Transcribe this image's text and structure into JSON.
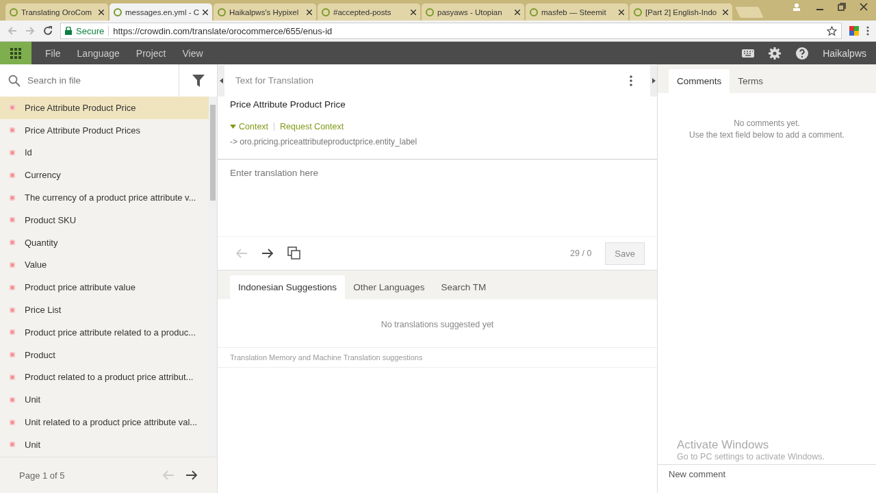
{
  "browser": {
    "tabs": [
      {
        "title": "Translating OroCom",
        "selected": false
      },
      {
        "title": "messages.en.yml - C",
        "selected": true
      },
      {
        "title": "Haikalpws's Hypixel",
        "selected": false
      },
      {
        "title": "#accepted-posts",
        "selected": false
      },
      {
        "title": "pasyaws - Utopian",
        "selected": false
      },
      {
        "title": "masfeb — Steemit",
        "selected": false
      },
      {
        "title": "[Part 2] English-Indo",
        "selected": false
      }
    ],
    "secure_label": "Secure",
    "url": "https://crowdin.com/translate/orocommerce/655/enus-id"
  },
  "menu": {
    "items": [
      "File",
      "Language",
      "Project",
      "View"
    ],
    "user": "Haikalpws"
  },
  "sidebar": {
    "search": {
      "placeholder": "Search in file"
    },
    "strings": [
      {
        "text": "Price Attribute Product Price",
        "selected": true
      },
      {
        "text": "Price Attribute Product Prices",
        "selected": false
      },
      {
        "text": "Id",
        "selected": false
      },
      {
        "text": "Currency",
        "selected": false
      },
      {
        "text": "The currency of a product price attribute v...",
        "selected": false
      },
      {
        "text": "Product SKU",
        "selected": false
      },
      {
        "text": "Quantity",
        "selected": false
      },
      {
        "text": "Value",
        "selected": false
      },
      {
        "text": "Product price attribute value",
        "selected": false
      },
      {
        "text": "Price List",
        "selected": false
      },
      {
        "text": "Product price attribute related to a produc...",
        "selected": false
      },
      {
        "text": "Product",
        "selected": false
      },
      {
        "text": "Product related to a product price attribut...",
        "selected": false
      },
      {
        "text": "Unit",
        "selected": false
      },
      {
        "text": "Unit related to a product price attribute val...",
        "selected": false
      },
      {
        "text": "Unit",
        "selected": false
      }
    ],
    "pager": "Page 1 of 5"
  },
  "source": {
    "heading": "Text for Translation",
    "text": "Price Attribute Product Price",
    "context_label": "Context",
    "request_context": "Request Context",
    "context_key": "-> oro.pricing.priceattributeproductprice.entity_label"
  },
  "editor": {
    "placeholder": "Enter translation here",
    "counter": "29 / 0",
    "save": "Save"
  },
  "suggestions": {
    "tabs": [
      {
        "label": "Indonesian Suggestions",
        "selected": true
      },
      {
        "label": "Other Languages",
        "selected": false
      },
      {
        "label": "Search TM",
        "selected": false
      }
    ],
    "empty": "No translations suggested yet",
    "footer": "Translation Memory and Machine Translation suggestions"
  },
  "comments": {
    "tabs": [
      {
        "label": "Comments",
        "selected": true
      },
      {
        "label": "Terms",
        "selected": false
      }
    ],
    "empty_lines": [
      "No comments yet.",
      "Use the text field below to add a comment."
    ],
    "new_comment": "New comment"
  },
  "os_notice": {
    "title": "Activate Windows",
    "text": "Go to PC settings to activate Windows."
  }
}
